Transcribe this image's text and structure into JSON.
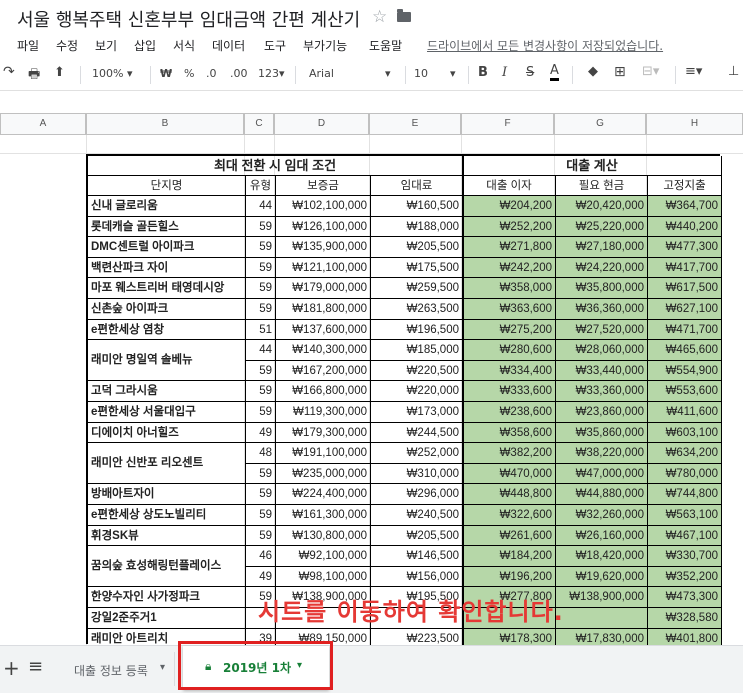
{
  "document": {
    "title": "서울 행복주택 신혼부부 임대금액 간편 계산기",
    "save_status": "드라이브에서 모든 변경사항이 저장되었습니다."
  },
  "menu": [
    "파일",
    "수정",
    "보기",
    "삽입",
    "서식",
    "데이터",
    "도구",
    "부가기능",
    "도움말"
  ],
  "toolbar": {
    "zoom": "100%",
    "currency": "₩",
    "percent": "%",
    "decrease_decimal": ".0",
    "increase_decimal": ".00",
    "number_format": "123",
    "font": "Arial",
    "font_size": "10",
    "bold": "B",
    "italic": "I",
    "strikethrough": "S",
    "text_color": "A"
  },
  "columns": [
    "A",
    "B",
    "C",
    "D",
    "E",
    "F",
    "G",
    "H"
  ],
  "table": {
    "group_left": "최대 전환 시 임대 조건",
    "group_right": "대출 계산",
    "headers": [
      "단지명",
      "유형",
      "보증금",
      "임대료",
      "대출 이자",
      "필요 현금",
      "고정지출"
    ],
    "rows": [
      {
        "name": "신내 글로리움",
        "type": "44",
        "deposit": "₩102,100,000",
        "rent": "₩160,500",
        "interest": "₩204,200",
        "cash": "₩20,420,000",
        "fixed": "₩364,700"
      },
      {
        "name": "롯데캐슬 골든힐스",
        "type": "59",
        "deposit": "₩126,100,000",
        "rent": "₩188,000",
        "interest": "₩252,200",
        "cash": "₩25,220,000",
        "fixed": "₩440,200"
      },
      {
        "name": "DMC센트럴 아이파크",
        "type": "59",
        "deposit": "₩135,900,000",
        "rent": "₩205,500",
        "interest": "₩271,800",
        "cash": "₩27,180,000",
        "fixed": "₩477,300"
      },
      {
        "name": "백련산파크 자이",
        "type": "59",
        "deposit": "₩121,100,000",
        "rent": "₩175,500",
        "interest": "₩242,200",
        "cash": "₩24,220,000",
        "fixed": "₩417,700"
      },
      {
        "name": "마포 웨스트리버 태영데시앙",
        "type": "59",
        "deposit": "₩179,000,000",
        "rent": "₩259,500",
        "interest": "₩358,000",
        "cash": "₩35,800,000",
        "fixed": "₩617,500"
      },
      {
        "name": "신촌숲 아이파크",
        "type": "59",
        "deposit": "₩181,800,000",
        "rent": "₩263,500",
        "interest": "₩363,600",
        "cash": "₩36,360,000",
        "fixed": "₩627,100"
      },
      {
        "name": "e편한세상 염창",
        "type": "51",
        "deposit": "₩137,600,000",
        "rent": "₩196,500",
        "interest": "₩275,200",
        "cash": "₩27,520,000",
        "fixed": "₩471,700"
      },
      {
        "name": "래미안 명일역 솔베뉴",
        "type": "44",
        "deposit": "₩140,300,000",
        "rent": "₩185,000",
        "interest": "₩280,600",
        "cash": "₩28,060,000",
        "fixed": "₩465,600"
      },
      {
        "name": "",
        "type": "59",
        "deposit": "₩167,200,000",
        "rent": "₩220,500",
        "interest": "₩334,400",
        "cash": "₩33,440,000",
        "fixed": "₩554,900"
      },
      {
        "name": "고덕 그라시움",
        "type": "59",
        "deposit": "₩166,800,000",
        "rent": "₩220,000",
        "interest": "₩333,600",
        "cash": "₩33,360,000",
        "fixed": "₩553,600"
      },
      {
        "name": "e편한세상 서울대입구",
        "type": "59",
        "deposit": "₩119,300,000",
        "rent": "₩173,000",
        "interest": "₩238,600",
        "cash": "₩23,860,000",
        "fixed": "₩411,600"
      },
      {
        "name": "디에이치 아너힐즈",
        "type": "49",
        "deposit": "₩179,300,000",
        "rent": "₩244,500",
        "interest": "₩358,600",
        "cash": "₩35,860,000",
        "fixed": "₩603,100"
      },
      {
        "name": "래미안 신반포 리오센트",
        "type": "48",
        "deposit": "₩191,100,000",
        "rent": "₩252,000",
        "interest": "₩382,200",
        "cash": "₩38,220,000",
        "fixed": "₩634,200"
      },
      {
        "name": "",
        "type": "59",
        "deposit": "₩235,000,000",
        "rent": "₩310,000",
        "interest": "₩470,000",
        "cash": "₩47,000,000",
        "fixed": "₩780,000"
      },
      {
        "name": "방배아트자이",
        "type": "59",
        "deposit": "₩224,400,000",
        "rent": "₩296,000",
        "interest": "₩448,800",
        "cash": "₩44,880,000",
        "fixed": "₩744,800"
      },
      {
        "name": "e편한세상 상도노빌리티",
        "type": "59",
        "deposit": "₩161,300,000",
        "rent": "₩240,500",
        "interest": "₩322,600",
        "cash": "₩32,260,000",
        "fixed": "₩563,100"
      },
      {
        "name": "휘경SK뷰",
        "type": "59",
        "deposit": "₩130,800,000",
        "rent": "₩205,500",
        "interest": "₩261,600",
        "cash": "₩26,160,000",
        "fixed": "₩467,100"
      },
      {
        "name": "꿈의숲 효성해링턴플레이스",
        "type": "46",
        "deposit": "₩92,100,000",
        "rent": "₩146,500",
        "interest": "₩184,200",
        "cash": "₩18,420,000",
        "fixed": "₩330,700"
      },
      {
        "name": "",
        "type": "49",
        "deposit": "₩98,100,000",
        "rent": "₩156,000",
        "interest": "₩196,200",
        "cash": "₩19,620,000",
        "fixed": "₩352,200"
      },
      {
        "name": "한양수자인 사가정파크",
        "type": "59",
        "deposit": "₩138,900,000",
        "rent": "₩195,500",
        "interest": "₩277,800",
        "cash": "₩138,900,000",
        "fixed": "₩473,300"
      },
      {
        "name": "강일2준주거1",
        "type": "",
        "deposit": "",
        "rent": "",
        "interest": "",
        "cash": "",
        "fixed": "₩328,580"
      },
      {
        "name": "래미안 아트리치",
        "type": "39",
        "deposit": "₩89,150,000",
        "rent": "₩223,500",
        "interest": "₩178,300",
        "cash": "₩17,830,000",
        "fixed": "₩401,800"
      }
    ]
  },
  "overlay_note": "시트를 이동하여 확인합니다.",
  "sheet_tabs": {
    "add": "+",
    "list": "≡",
    "tab1": "대출 정보 등록",
    "tab2": "2019년 1차"
  },
  "colors": {
    "green_fill": "#b6d7a8",
    "accent_red": "#e53935",
    "active_tab": "#188038"
  }
}
